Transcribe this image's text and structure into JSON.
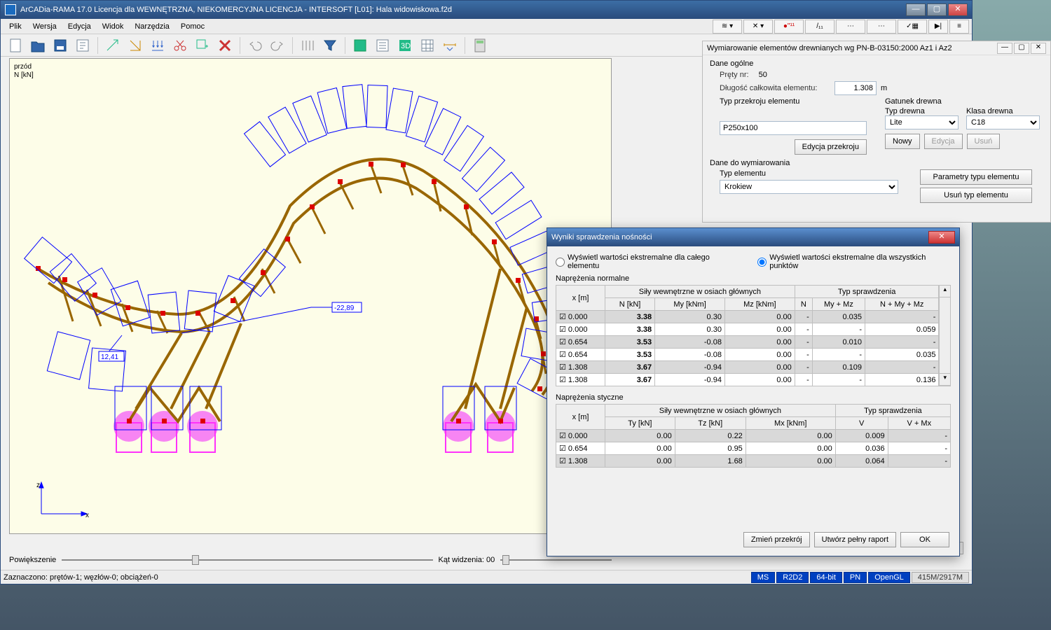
{
  "title": "ArCADia-RAMA 17.0 Licencja dla WEWNĘTRZNA, NIEKOMERCYJNA LICENCJA - INTERSOFT [L01]: Hala widowiskowa.f2d",
  "menu": [
    "Plik",
    "Wersja",
    "Edycja",
    "Widok",
    "Narzędzia",
    "Pomoc"
  ],
  "canvas": {
    "label_front": "przód",
    "label_unit": "N [kN]",
    "val1": "12,41",
    "val2": "-22,89",
    "axis_x": "x",
    "axis_z": "z"
  },
  "bottom": {
    "zoom_label": "Powiększenie",
    "angle_label": "Kąt widzenia: 00"
  },
  "status": {
    "selection": "Zaznaczono: prętów-1; węzłów-0; obciążeń-0",
    "pills": [
      "MS",
      "R2D2",
      "64-bit",
      "PN",
      "OpenGL"
    ],
    "mem": "415M/2917M"
  },
  "side": {
    "title": "Wymiarowanie elementów drewnianych wg PN-B-03150:2000 Az1 i Az2",
    "s1": "Dane ogólne",
    "prety_label": "Pręty nr:",
    "prety_val": "50",
    "dlugosc_label": "Długość całkowita elementu:",
    "dlugosc_val": "1.308",
    "dlugosc_unit": "m",
    "typ_przekroju_label": "Typ przekroju elementu",
    "gatunek_label": "Gatunek drewna",
    "typdrewna_label": "Typ drewna",
    "klasa_label": "Klasa drewna",
    "przekroj_val": "P250x100",
    "typdrewna_val": "Lite",
    "klasa_val": "C18",
    "btn_edycja_przekroju": "Edycja przekroju",
    "btn_nowy": "Nowy",
    "btn_edycja": "Edycja",
    "btn_usun": "Usuń",
    "s2": "Dane do wymiarowania",
    "typ_elementu_label": "Typ elementu",
    "typ_elementu_val": "Krokiew",
    "btn_param": "Parametry typu elementu",
    "btn_usuntyp": "Usuń typ elementu"
  },
  "dlg": {
    "title": "Wyniki sprawdzenia nośności",
    "radio1": "Wyświetl wartości ekstremalne dla całego elementu",
    "radio2": "Wyświetl wartości ekstremalne dla wszystkich punktów",
    "sect1": "Naprężenia normalne",
    "sect2": "Naprężenia styczne",
    "col_x": "x [m]",
    "col_sily": "Siły wewnętrzne w osiach głównych",
    "col_typ": "Typ sprawdzenia",
    "col_N": "N [kN]",
    "col_My": "My [kNm]",
    "col_Mz": "Mz [kNm]",
    "col_Nchk": "N",
    "col_MyMz": "My + Mz",
    "col_NMyMz": "N + My + Mz",
    "col_Ty": "Ty [kN]",
    "col_Tz": "Tz [kN]",
    "col_Mx": "Mx [kNm]",
    "col_V": "V",
    "col_VMx": "V + Mx",
    "rows1": [
      {
        "x": "0.000",
        "N": "3.38",
        "My": "0.30",
        "Mz": "0.00",
        "cN": "-",
        "cMyMz": "0.035",
        "cNMyMz": "-"
      },
      {
        "x": "0.000",
        "N": "3.38",
        "My": "0.30",
        "Mz": "0.00",
        "cN": "-",
        "cMyMz": "-",
        "cNMyMz": "0.059"
      },
      {
        "x": "0.654",
        "N": "3.53",
        "My": "-0.08",
        "Mz": "0.00",
        "cN": "-",
        "cMyMz": "0.010",
        "cNMyMz": "-"
      },
      {
        "x": "0.654",
        "N": "3.53",
        "My": "-0.08",
        "Mz": "0.00",
        "cN": "-",
        "cMyMz": "-",
        "cNMyMz": "0.035"
      },
      {
        "x": "1.308",
        "N": "3.67",
        "My": "-0.94",
        "Mz": "0.00",
        "cN": "-",
        "cMyMz": "0.109",
        "cNMyMz": "-"
      },
      {
        "x": "1.308",
        "N": "3.67",
        "My": "-0.94",
        "Mz": "0.00",
        "cN": "-",
        "cMyMz": "-",
        "cNMyMz": "0.136"
      }
    ],
    "rows2": [
      {
        "x": "0.000",
        "Ty": "0.00",
        "Tz": "0.22",
        "Mx": "0.00",
        "V": "0.009",
        "VMx": "-"
      },
      {
        "x": "0.654",
        "Ty": "0.00",
        "Tz": "0.95",
        "Mx": "0.00",
        "V": "0.036",
        "VMx": "-"
      },
      {
        "x": "1.308",
        "Ty": "0.00",
        "Tz": "1.68",
        "Mx": "0.00",
        "V": "0.064",
        "VMx": "-"
      }
    ],
    "btn_zmien": "Zmień przekrój",
    "btn_raport": "Utwórz pełny raport",
    "btn_ok": "OK"
  }
}
